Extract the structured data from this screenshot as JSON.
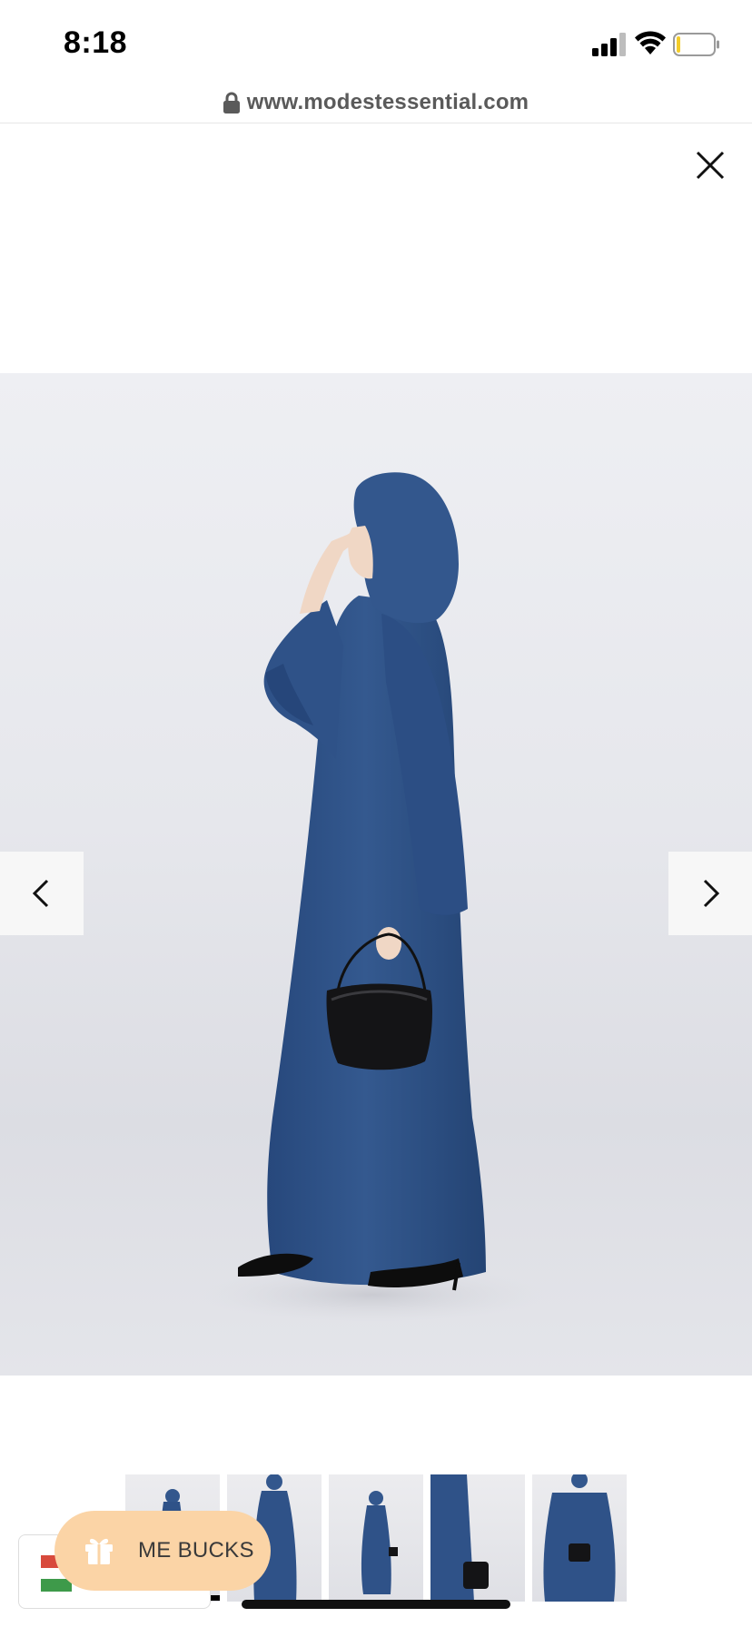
{
  "status_bar": {
    "time": "8:18",
    "icons": [
      "signal-icon",
      "wifi-icon",
      "battery-icon"
    ]
  },
  "browser": {
    "url": "www.modestessential.com",
    "lock_icon": "lock-icon"
  },
  "gallery": {
    "close_icon": "close-icon",
    "prev_icon": "chevron-left-icon",
    "next_icon": "chevron-right-icon",
    "thumbnail_count": 5,
    "selected_thumbnail": 1
  },
  "me_bucks": {
    "label": "ME BUCKS",
    "icon": "gift-icon",
    "background": "#fbd4a6"
  },
  "colors": {
    "garment_blue": "#2f5288",
    "accent": "#fbd4a6"
  }
}
